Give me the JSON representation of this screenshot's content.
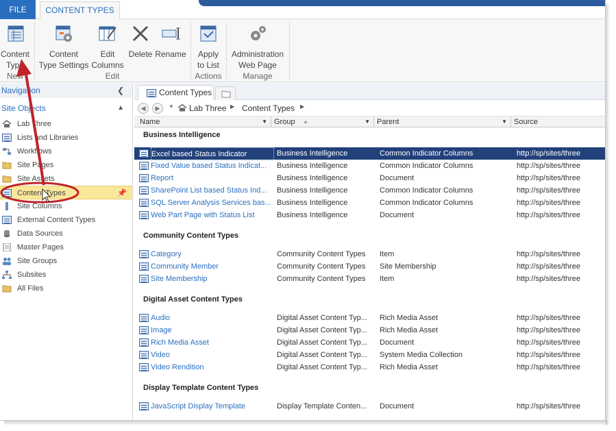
{
  "tabs": {
    "file": "FILE",
    "content_types": "CONTENT TYPES"
  },
  "ribbon": {
    "content_type": [
      "Content",
      "Type"
    ],
    "content_type_settings": [
      "Content",
      "Type Settings"
    ],
    "edit_columns": [
      "Edit",
      "Columns"
    ],
    "delete": "Delete",
    "rename": "Rename",
    "apply_to_list": [
      "Apply",
      "to List"
    ],
    "admin_web_page": [
      "Administration",
      "Web Page"
    ],
    "groups": {
      "new": "New",
      "edit": "Edit",
      "actions": "Actions",
      "manage": "Manage"
    }
  },
  "nav": {
    "header": "Navigation",
    "section": "Site Objects",
    "items": [
      {
        "label": "Lab Three",
        "icon": "home-icon"
      },
      {
        "label": "Lists and Libraries",
        "icon": "list-icon"
      },
      {
        "label": "Workflows",
        "icon": "workflow-icon"
      },
      {
        "label": "Site Pages",
        "icon": "folder-icon"
      },
      {
        "label": "Site Assets",
        "icon": "folder-icon"
      },
      {
        "label": "Content Types",
        "icon": "list-icon"
      },
      {
        "label": "Site Columns",
        "icon": "column-icon"
      },
      {
        "label": "External Content Types",
        "icon": "list-icon"
      },
      {
        "label": "Data Sources",
        "icon": "database-icon"
      },
      {
        "label": "Master Pages",
        "icon": "page-icon"
      },
      {
        "label": "Site Groups",
        "icon": "group-icon"
      },
      {
        "label": "Subsites",
        "icon": "sitemap-icon"
      },
      {
        "label": "All Files",
        "icon": "folder-icon"
      }
    ]
  },
  "doc_tab": {
    "label": "Content Types"
  },
  "breadcrumb": {
    "site": "Lab Three",
    "page": "Content Types"
  },
  "columns": {
    "name": "Name",
    "group": "Group",
    "parent": "Parent",
    "source": "Source"
  },
  "groups": [
    {
      "title": "Business Intelligence",
      "rows": [
        {
          "name": "Excel based Status Indicator",
          "group": "Business Intelligence",
          "parent": "Common Indicator Columns",
          "source": "http://sp/sites/three"
        },
        {
          "name": "Fixed Value based Status Indicat...",
          "group": "Business Intelligence",
          "parent": "Common Indicator Columns",
          "source": "http://sp/sites/three"
        },
        {
          "name": "Report",
          "group": "Business Intelligence",
          "parent": "Document",
          "source": "http://sp/sites/three"
        },
        {
          "name": "SharePoint List based Status Ind...",
          "group": "Business Intelligence",
          "parent": "Common Indicator Columns",
          "source": "http://sp/sites/three"
        },
        {
          "name": "SQL Server Analysis Services bas...",
          "group": "Business Intelligence",
          "parent": "Common Indicator Columns",
          "source": "http://sp/sites/three"
        },
        {
          "name": "Web Part Page with Status List",
          "group": "Business Intelligence",
          "parent": "Document",
          "source": "http://sp/sites/three"
        }
      ]
    },
    {
      "title": "Community Content Types",
      "rows": [
        {
          "name": "Category",
          "group": "Community Content Types",
          "parent": "Item",
          "source": "http://sp/sites/three"
        },
        {
          "name": "Community Member",
          "group": "Community Content Types",
          "parent": "Site Membership",
          "source": "http://sp/sites/three"
        },
        {
          "name": "Site Membership",
          "group": "Community Content Types",
          "parent": "Item",
          "source": "http://sp/sites/three"
        }
      ]
    },
    {
      "title": "Digital Asset Content Types",
      "rows": [
        {
          "name": "Audio",
          "group": "Digital Asset Content Typ...",
          "parent": "Rich Media Asset",
          "source": "http://sp/sites/three"
        },
        {
          "name": "Image",
          "group": "Digital Asset Content Typ...",
          "parent": "Rich Media Asset",
          "source": "http://sp/sites/three"
        },
        {
          "name": "Rich Media Asset",
          "group": "Digital Asset Content Typ...",
          "parent": "Document",
          "source": "http://sp/sites/three"
        },
        {
          "name": "Video",
          "group": "Digital Asset Content Typ...",
          "parent": "System Media Collection",
          "source": "http://sp/sites/three"
        },
        {
          "name": "Video Rendition",
          "group": "Digital Asset Content Typ...",
          "parent": "Rich Media Asset",
          "source": "http://sp/sites/three"
        }
      ]
    },
    {
      "title": "Display Template Content Types",
      "rows": [
        {
          "name": "JavaScript Display Template",
          "group": "Display Template Conten...",
          "parent": "Document",
          "source": "http://sp/sites/three"
        }
      ]
    }
  ],
  "colors": {
    "accent": "#2a6fbf",
    "selected_row": "#22417a",
    "selected_nav": "#f9e79a",
    "annotation": "#c0232b"
  }
}
